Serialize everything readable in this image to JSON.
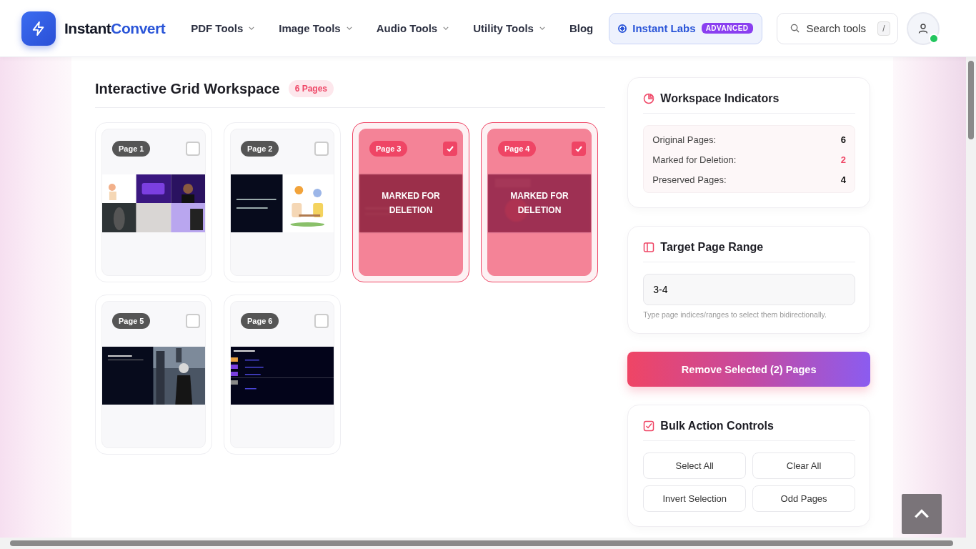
{
  "header": {
    "logo_parts": [
      "Instant",
      "Convert"
    ],
    "nav": [
      {
        "label": "PDF Tools",
        "dropdown": true
      },
      {
        "label": "Image Tools",
        "dropdown": true
      },
      {
        "label": "Audio Tools",
        "dropdown": true
      },
      {
        "label": "Utility Tools",
        "dropdown": true
      },
      {
        "label": "Blog",
        "dropdown": false
      }
    ],
    "labs": {
      "label": "Instant Labs",
      "badge": "ADVANCED",
      "selected": true
    },
    "search": {
      "placeholder": "Search tools",
      "shortcut": "/"
    },
    "user": {
      "online": true
    }
  },
  "workspace": {
    "title": "Interactive Grid Workspace",
    "count": "6 Pages",
    "pages": [
      {
        "label": "Page 1",
        "selected": false
      },
      {
        "label": "Page 2",
        "selected": false
      },
      {
        "label": "Page 3",
        "selected": true,
        "overlay": "MARKED FOR DELETION"
      },
      {
        "label": "Page 4",
        "selected": true,
        "overlay": "MARKED FOR DELETION"
      },
      {
        "label": "Page 5",
        "selected": false
      },
      {
        "label": "Page 6",
        "selected": false
      }
    ]
  },
  "indicators": {
    "title": "Workspace Indicators",
    "rows": [
      {
        "label": "Original Pages:",
        "value": "6",
        "kind": "normal"
      },
      {
        "label": "Marked for Deletion:",
        "value": "2",
        "kind": "alert"
      },
      {
        "label": "Preserved Pages:",
        "value": "4",
        "kind": "normal"
      }
    ]
  },
  "range": {
    "title": "Target Page Range",
    "value": "3-4",
    "hint": "Type page indices/ranges to select them bidirectionally."
  },
  "remove_button": "Remove Selected (2) Pages",
  "bulk": {
    "title": "Bulk Action Controls",
    "buttons": [
      "Select All",
      "Clear All",
      "Invert Selection",
      "Odd Pages"
    ]
  }
}
